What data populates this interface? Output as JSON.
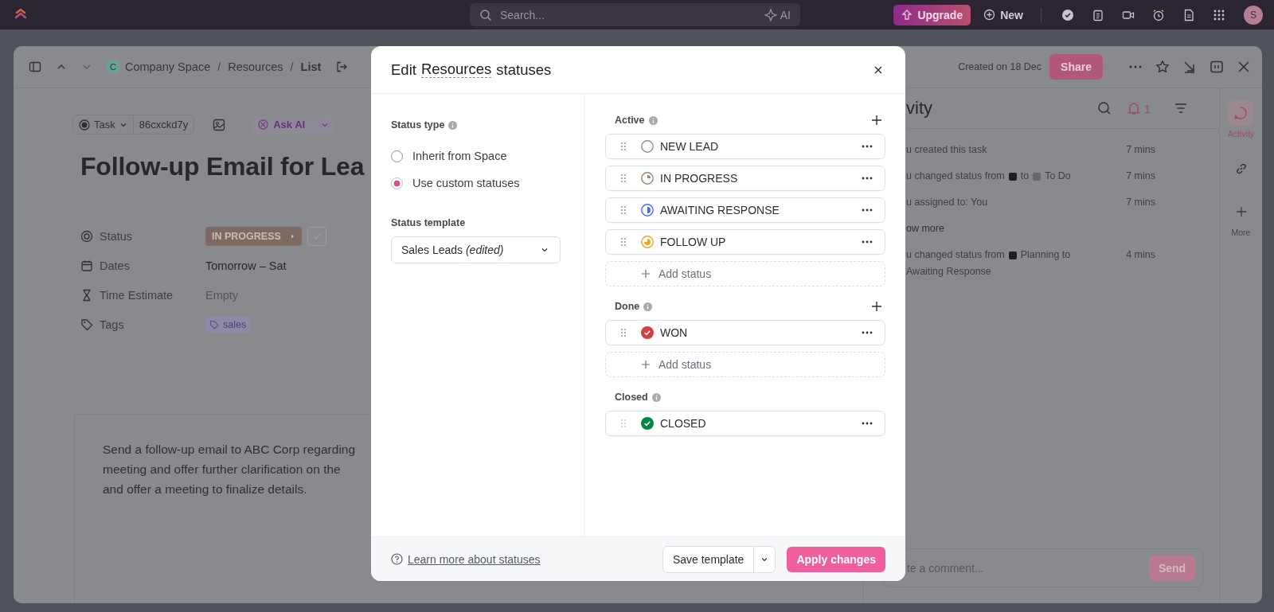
{
  "top_bar": {
    "search_placeholder": "Search...",
    "ai_label": "AI",
    "upgrade": "Upgrade",
    "new": "New",
    "avatar": "S"
  },
  "breadcrumb": {
    "badge": "C",
    "separator": "/",
    "items": [
      "Company Space",
      "Resources",
      "List"
    ]
  },
  "task_header": {
    "created": "Created on 18 Dec",
    "share": "Share"
  },
  "task": {
    "type": "Task",
    "id": "86cxckd7y",
    "ask_ai": "Ask AI",
    "title": "Follow-up Email for Lea",
    "fields": [
      {
        "kind": "status",
        "label": "Status",
        "value": "IN PROGRESS"
      },
      {
        "kind": "dates",
        "label": "Dates",
        "value": "Tomorrow – Sat"
      },
      {
        "kind": "time",
        "label": "Time Estimate",
        "value": "Empty"
      },
      {
        "kind": "tags",
        "label": "Tags",
        "value": "sales"
      }
    ],
    "description": [
      "Send a follow-up email to ABC Corp regarding",
      "meeting and offer further clarification on the",
      "and offer a meeting to finalize details."
    ]
  },
  "activity": {
    "title": "vity",
    "notifications": "1",
    "entries": [
      {
        "time": "7 mins",
        "segments": [
          {
            "kind": "text",
            "text": "u created this task"
          }
        ]
      },
      {
        "time": "7 mins",
        "segments": [
          {
            "kind": "text",
            "text": "u changed status from"
          },
          {
            "kind": "swatch",
            "color": "#1e1e22"
          },
          {
            "kind": "text",
            "text": "to"
          },
          {
            "kind": "swatch",
            "color": "#66676c"
          },
          {
            "kind": "text",
            "text": "To Do"
          }
        ]
      },
      {
        "time": "7 mins",
        "segments": [
          {
            "kind": "text",
            "text": "u assigned to: You"
          }
        ]
      },
      {
        "segments": [
          {
            "kind": "link",
            "text": "ow more"
          }
        ]
      },
      {
        "time": "4 mins",
        "segments": [
          {
            "kind": "text",
            "text": "u changed status from"
          },
          {
            "kind": "swatch",
            "color": "#1e1e22"
          },
          {
            "kind": "text",
            "text": "Planning to"
          },
          {
            "kind": "text",
            "text": "Awaiting Response"
          }
        ]
      }
    ],
    "comment_placeholder": "te a comment...",
    "send": "Send"
  },
  "rail": [
    {
      "kind": "activity",
      "label": "Activity",
      "selected": true
    },
    {
      "kind": "link",
      "selected": false
    },
    {
      "kind": "more",
      "label": "More",
      "selected": false
    }
  ],
  "modal": {
    "title_before": "Edit",
    "title_link": "Resources",
    "title_after": "statuses",
    "status_type_label": "Status type",
    "options": [
      {
        "label": "Inherit from Space",
        "selected": false
      },
      {
        "label": "Use custom statuses",
        "selected": true
      }
    ],
    "template_label": "Status template",
    "template_value": "Sales Leads *(edited)*",
    "groups": [
      {
        "name": "Active",
        "addable": true,
        "add_label": "Add status",
        "statuses": [
          {
            "name": "NEW LEAD",
            "kind": "open",
            "color": "#87909e"
          },
          {
            "name": "IN PROGRESS",
            "kind": "quarter",
            "color": "#a0826d"
          },
          {
            "name": "AWAITING RESPONSE",
            "kind": "half",
            "color": "#4466ff"
          },
          {
            "name": "FOLLOW UP",
            "kind": "three_quarter",
            "color": "#f5a623"
          }
        ]
      },
      {
        "name": "Done",
        "addable": true,
        "add_label": "Add status",
        "statuses": [
          {
            "name": "WON",
            "kind": "check",
            "color": "#d33d44"
          }
        ]
      },
      {
        "name": "Closed",
        "addable": false,
        "statuses": [
          {
            "name": "CLOSED",
            "kind": "check",
            "color": "#008844"
          }
        ]
      }
    ],
    "learn_more": "Learn more about statuses",
    "save_template": "Save template",
    "apply": "Apply changes"
  }
}
